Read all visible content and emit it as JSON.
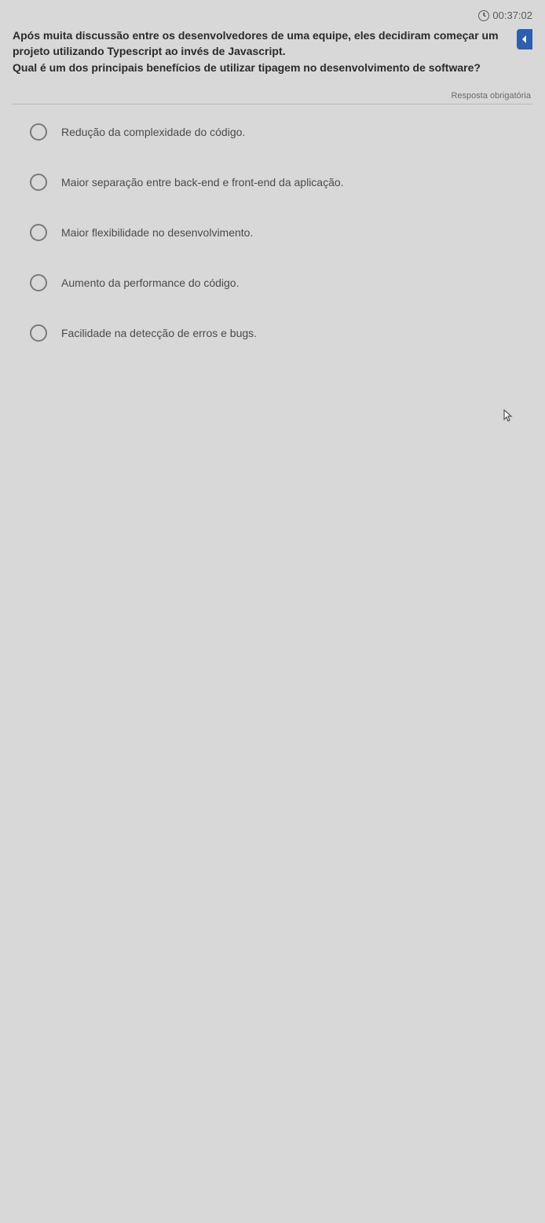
{
  "timer": "00:37:02",
  "question": {
    "line1": "Após muita discussão entre os desenvolvedores de uma equipe, eles decidiram começar um projeto utilizando Typescript ao invés de Javascript.",
    "line2": "Qual é um dos principais benefícios de utilizar tipagem no desenvolvimento de software?"
  },
  "required_label": "Resposta obrigatória",
  "options": [
    {
      "label": "Redução da complexidade do código."
    },
    {
      "label": "Maior separação entre back-end e front-end da aplicação."
    },
    {
      "label": "Maior flexibilidade no desenvolvimento."
    },
    {
      "label": "Aumento da performance do código."
    },
    {
      "label": "Facilidade na detecção de erros e bugs."
    }
  ]
}
